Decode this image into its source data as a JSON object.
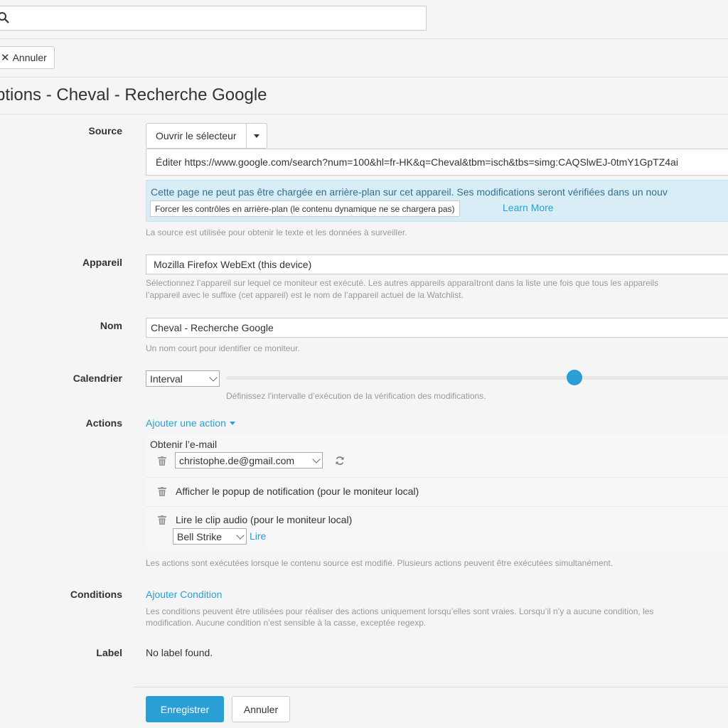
{
  "search": {
    "value": ""
  },
  "toolbar": {
    "cancel_label": "Annuler"
  },
  "page_title": "ptions - Cheval - Recherche Google",
  "source": {
    "label": "Source",
    "open_selector": "Ouvrir le sélecteur",
    "edit_url": "Éditer https://www.google.com/search?num=100&hl=fr-HK&q=Cheval&tbm=isch&tbs=simg:CAQSlwEJ-0tmY1GpTZ4ai",
    "info_text": "Cette page ne peut pas être chargée en arrière-plan sur cet appareil. Ses modifications seront vérifiées dans un nouv",
    "force_button": "Forcer les contrôles en arrière-plan (le contenu dynamique ne se chargera pas)",
    "learn_more": "Learn More",
    "help": "La source est utilisée pour obtenir le texte et les données à surveiller."
  },
  "device": {
    "label": "Appareil",
    "value": "Mozilla Firefox WebExt (this device)",
    "help_line1": "Sélectionnez l’appareil sur lequel ce moniteur est exécuté. Les autres appareils apparaîtront dans la liste une fois que tous les appareils",
    "help_line2": "l’appareil avec le suffixe (cet appareil) est le nom de l’appareil actuel de la Watchlist."
  },
  "name": {
    "label": "Nom",
    "value": "Cheval - Recherche Google",
    "help": "Un nom court pour identifier ce moniteur."
  },
  "schedule": {
    "label": "Calendrier",
    "select_value": "Interval",
    "help": "Définissez l’intervalle d’exécution de la vérification des modifications.",
    "slider_fraction": 0.68
  },
  "actions": {
    "label": "Actions",
    "add_action": "Ajouter une action",
    "email_title": "Obtenir l’e-mail",
    "email_value": "christophe.de@gmail.com",
    "popup_label": "Afficher le popup de notification (pour le moniteur local)",
    "audio_label": "Lire le clip audio (pour le moniteur local)",
    "audio_value": "Bell Strike",
    "play_link": "Lire",
    "help": "Les actions sont exécutées lorsque le contenu source est modifié. Plusieurs actions peuvent être exécutées simultanément."
  },
  "conditions": {
    "label": "Conditions",
    "add_condition": "Ajouter Condition",
    "help_line1": "Les conditions peuvent être utilisées pour réaliser des actions uniquement lorsqu’elles sont vraies. Lorsqu’il n’y a aucune condition, les",
    "help_line2": "modification. Aucune condition n’est sensible à la casse, exceptée regexp."
  },
  "label_field": {
    "label": "Label",
    "value": "No label found."
  },
  "footer": {
    "save": "Enregistrer",
    "cancel": "Annuler"
  },
  "colors": {
    "accent": "#2a9fd6",
    "info_bg": "#d9edf7",
    "info_text": "#31708f"
  }
}
